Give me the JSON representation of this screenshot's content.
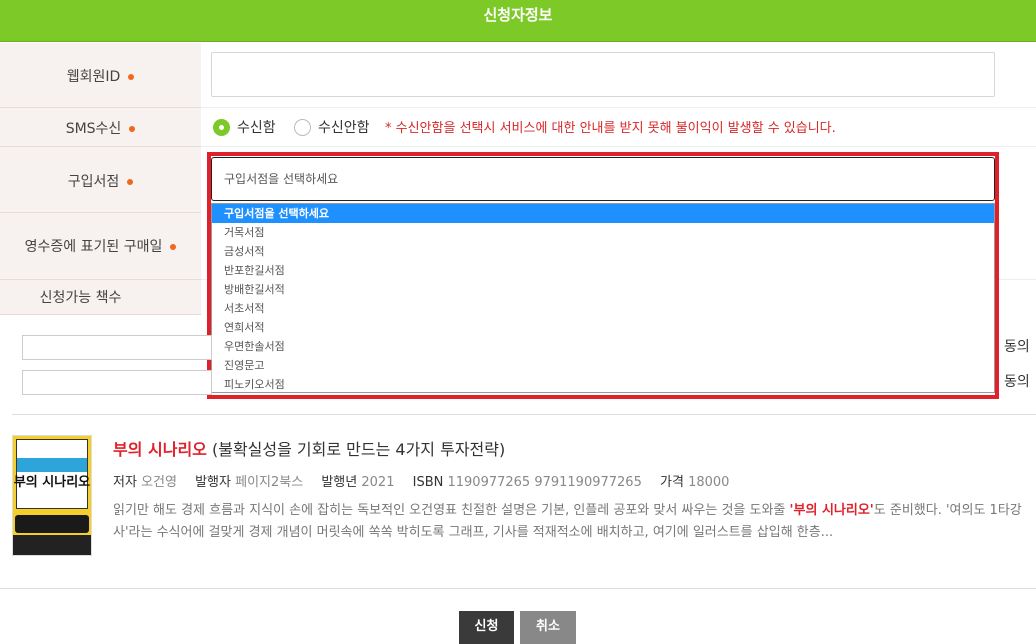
{
  "header": {
    "title": "신청자정보"
  },
  "fields": {
    "member_id": {
      "label": "웹회원ID",
      "value": ""
    },
    "sms": {
      "label": "SMS수신",
      "opt_yes": "수신함",
      "opt_no": "수신안함",
      "notice": "* 수신안함을 선택시 서비스에 대한 안내를 받지 못해 불이익이 발생할 수 있습니다."
    },
    "bookstore": {
      "label": "구입서점",
      "selected": "구입서점을 선택하세요",
      "options": [
        "구입서점을 선택하세요",
        "거목서점",
        "금성서적",
        "반포한길서점",
        "방배한길서적",
        "서초서적",
        "연희서적",
        "우면한솔서점",
        "진영문고",
        "피노키오서점"
      ]
    },
    "purchase_date": {
      "label": "영수증에 표기된 구매일"
    },
    "available": {
      "label": "신청가능 책수"
    }
  },
  "agree": {
    "text1": "동의",
    "text2": "동의"
  },
  "book": {
    "title_main": "부의 시나리오",
    "title_sub": "(불확실성을 기회로 만드는 4가지 투자전략)",
    "author_label": "저자",
    "author": "오건영",
    "publisher_label": "발행자",
    "publisher": "페이지2북스",
    "year_label": "발행년",
    "year": "2021",
    "isbn_label": "ISBN",
    "isbn": "1190977265 9791190977265",
    "price_label": "가격",
    "price": "18000",
    "desc_1": "읽기만 해도 경제 흐름과 지식이 손에 잡히는 독보적인 오건영표 친절한 설명은 기본, 인플레 공포와 맞서 싸우는 것을 도와줄 ",
    "desc_hl": "'부의 시나리오'",
    "desc_2": "도 준비했다. '여의도 1타강사'라는 수식어에 걸맞게 경제 개념이 머릿속에 쏙쏙 박히도록 그래프, 기사를 적재적소에 배치하고, 여기에 일러스트를 삽입해 한층...",
    "cover_title": "부의 시나리오"
  },
  "buttons": {
    "apply": "신청",
    "cancel": "취소"
  },
  "colors": {
    "accent": "#7dc928",
    "required": "#f0681e",
    "highlight": "#e0212b",
    "option_selected": "#1e90ff"
  }
}
